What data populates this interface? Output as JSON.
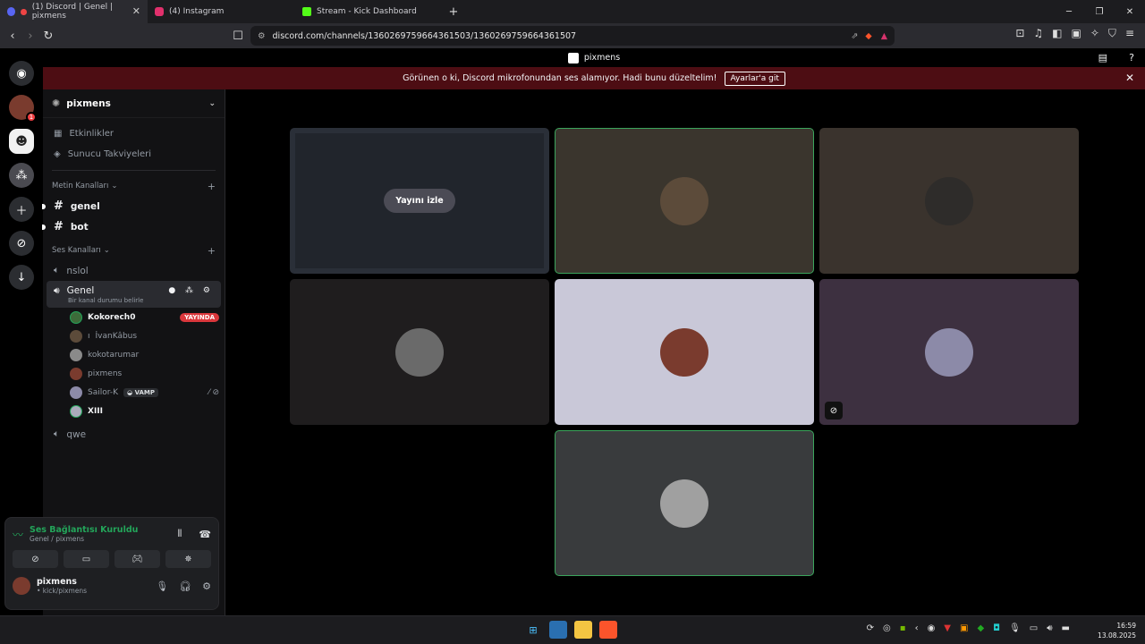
{
  "browser": {
    "tabs": [
      {
        "label": "(1) Discord | Genel | pixmens",
        "active": true,
        "color": "#5865f2"
      },
      {
        "label": "(4) Instagram",
        "active": false,
        "color": "#e1306c"
      },
      {
        "label": "Stream - Kick Dashboard",
        "active": false,
        "color": "#53fc18"
      }
    ],
    "url": "discord.com/channels/1360269759664361503/1360269759664361507"
  },
  "discord": {
    "title": "pixmens",
    "warning": {
      "text": "Görünen o ki, Discord mikrofonundan ses alamıyor. Hadi bunu düzeltelim!",
      "button": "Ayarlar'a git"
    },
    "rail": {
      "dm_badge": "1"
    },
    "server": {
      "name": "pixmens"
    },
    "menu": [
      {
        "label": "Etkinlikler",
        "icon": "calendar-icon"
      },
      {
        "label": "Sunucu Takviyeleri",
        "icon": "boost-icon"
      }
    ],
    "text_category": "Metin Kanalları",
    "text_channels": [
      {
        "name": "genel"
      },
      {
        "name": "bot"
      }
    ],
    "voice_category": "Ses Kanalları",
    "voice_channels": {
      "first": "nslol",
      "selected": {
        "name": "Genel",
        "status": "Bir kanal durumu belirle"
      },
      "last": "qwe"
    },
    "users": [
      {
        "name": "Kokorech0",
        "live": "YAYINDA",
        "bold": true
      },
      {
        "name": "İvanKâbus",
        "prefix": "ı"
      },
      {
        "name": "kokotarumar"
      },
      {
        "name": "pixmens"
      },
      {
        "name": "Sailor-K",
        "tag": "VAMP"
      },
      {
        "name": "XIII",
        "bold": true
      }
    ],
    "connection": {
      "status": "Ses Bağlantısı Kuruldu",
      "location": "Genel / pixmens"
    },
    "me": {
      "name": "pixmens",
      "status": "• kick/pixmens"
    },
    "stream": {
      "watch": "Yayını izle"
    }
  },
  "taskbar": {
    "time": "16:59",
    "date": "13.08.2025"
  }
}
